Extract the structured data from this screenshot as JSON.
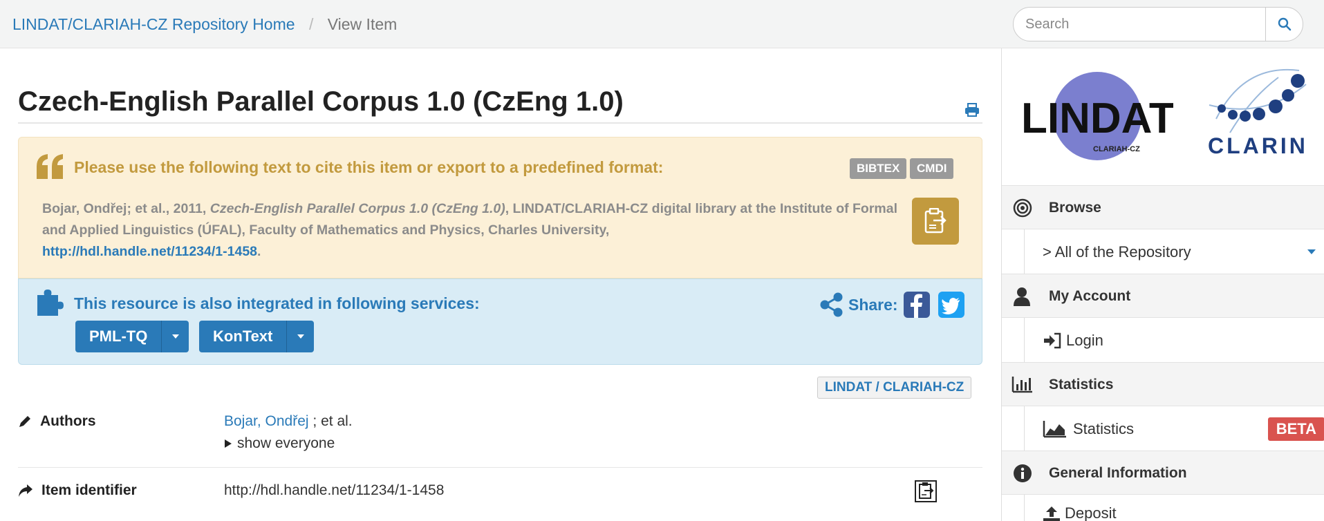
{
  "breadcrumb": {
    "home": "LINDAT/CLARIAH-CZ Repository Home",
    "separator": "/",
    "current": "View Item"
  },
  "search": {
    "placeholder": "Search",
    "button_icon": "search-icon"
  },
  "item": {
    "title": "Czech-English Parallel Corpus 1.0 (CzEng 1.0)"
  },
  "citation": {
    "heading": "Please use the following text to cite this item or export to a predefined format:",
    "export_formats": [
      "BIBTEX",
      "CMDI"
    ],
    "text_prefix": "Bojar, Ondřej; et al., 2011, ",
    "text_title": "Czech-English Parallel Corpus 1.0 (CzEng 1.0)",
    "text_suffix": ", LINDAT/CLARIAH-CZ digital library at the Institute of Formal and Applied Linguistics (ÚFAL), Faculty of Mathematics and Physics, Charles University,",
    "handle_link": "http://hdl.handle.net/11234/1-1458",
    "text_end": "."
  },
  "services": {
    "heading": "This resource is also integrated in following services:",
    "buttons": [
      "PML-TQ",
      "KonText"
    ],
    "share_label": "Share:"
  },
  "repository_badge": "LINDAT / CLARIAH-CZ",
  "metadata": {
    "authors": {
      "label": "Authors",
      "author": "Bojar, Ondřej",
      "et_al": "; et al.",
      "show_everyone": "show everyone"
    },
    "identifier": {
      "label": "Item identifier",
      "value": "http://hdl.handle.net/11234/1-1458"
    }
  },
  "logos": {
    "lindat": "LINDAT",
    "lindat_sub": "CLARIAH-CZ",
    "clarin": "CLARIN"
  },
  "sidebar": {
    "browse": {
      "heading": "Browse",
      "item": "> All of the Repository"
    },
    "account": {
      "heading": "My Account",
      "item": "Login"
    },
    "statistics": {
      "heading": "Statistics",
      "item": "Statistics",
      "badge": "BETA"
    },
    "general": {
      "heading": "General Information",
      "item": "Deposit"
    }
  },
  "colors": {
    "link": "#2a7ab8",
    "cite_bg": "#fcf0d7",
    "cite_accent": "#c29a3e",
    "services_bg": "#d9ecf6",
    "beta": "#d9534f"
  }
}
